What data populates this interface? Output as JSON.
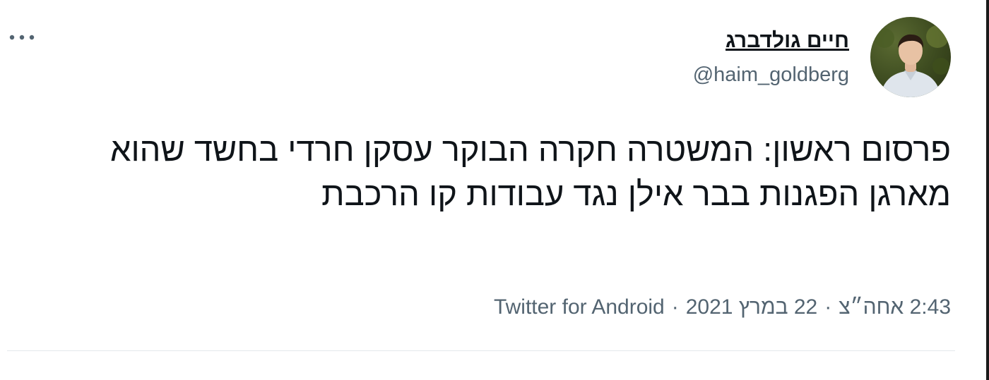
{
  "user": {
    "display_name": "חיים גולדברג",
    "handle": "@haim_goldberg"
  },
  "tweet": {
    "text": "פרסום ראשון: המשטרה חקרה הבוקר עסקן חרדי בחשד שהוא מארגן הפגנות בבר אילן נגד עבודות קו הרכבת"
  },
  "meta": {
    "time": "2:43 אחה״צ",
    "date": "22 במרץ 2021",
    "source": "Twitter for Android",
    "separator": "·"
  },
  "icons": {
    "more": "more-horizontal-icon"
  },
  "colors": {
    "text": "#0f1419",
    "secondary": "#536471",
    "divider": "#e4e8eb"
  }
}
